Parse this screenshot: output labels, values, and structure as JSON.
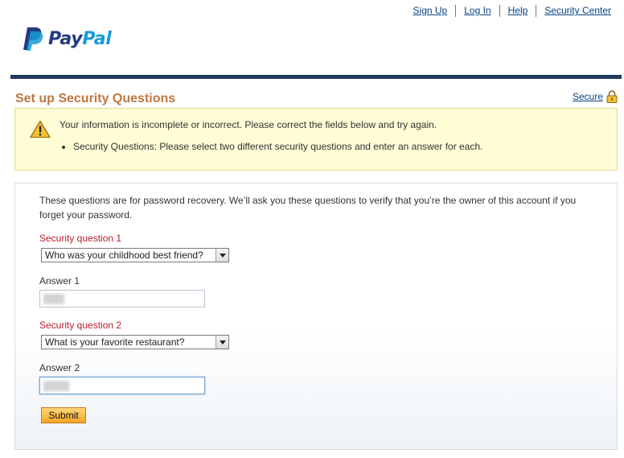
{
  "nav": {
    "sign_up": "Sign Up",
    "log_in": "Log In",
    "help": "Help",
    "security_center": "Security Center"
  },
  "brand": {
    "pay": "Pay",
    "pal": "Pal",
    "color_dark": "#253b80",
    "color_light": "#179bd7"
  },
  "page": {
    "title": "Set up Security Questions",
    "secure_link": "Secure"
  },
  "alert": {
    "message": "Your information is incomplete or incorrect. Please correct the fields below and try again.",
    "items": [
      "Security Questions: Please select two different security questions and enter an answer for each."
    ]
  },
  "form": {
    "intro": "These questions are for password recovery. We’ll ask you these questions to verify that you’re the owner of this account if you forget your password.",
    "q1_label": "Security question 1",
    "q1_value": "Who was your childhood best friend?",
    "a1_label": "Answer 1",
    "q2_label": "Security question 2",
    "q2_value": "What is your favorite restaurant?",
    "a2_label": "Answer 2",
    "submit_label": "Submit"
  },
  "colors": {
    "title": "#c0763f",
    "error_label": "#b51f2d",
    "link": "#084482",
    "header_bar": "#1f3a5a"
  }
}
